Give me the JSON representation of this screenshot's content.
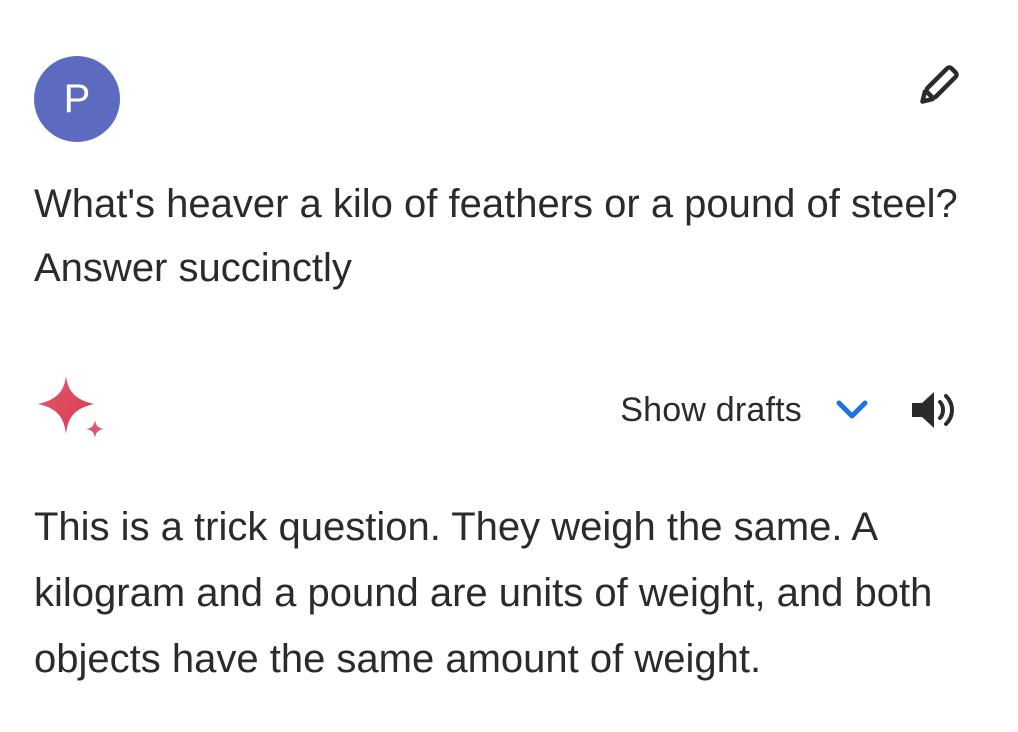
{
  "user": {
    "avatar_initial": "P",
    "avatar_color": "#5c6bc0",
    "edit_icon": "pencil-icon",
    "prompt": "What's heaver a kilo of feathers or a pound of steel? Answer succinctly"
  },
  "response": {
    "assistant_icon": "sparkle-icon",
    "show_drafts_label": "Show drafts",
    "chevron_icon": "chevron-down-icon",
    "chevron_color": "#1a73e8",
    "speaker_icon": "speaker-icon",
    "text": "This is a trick question. They weigh the same. A kilogram and a pound are units of weight, and both objects have the same amount of weight."
  }
}
